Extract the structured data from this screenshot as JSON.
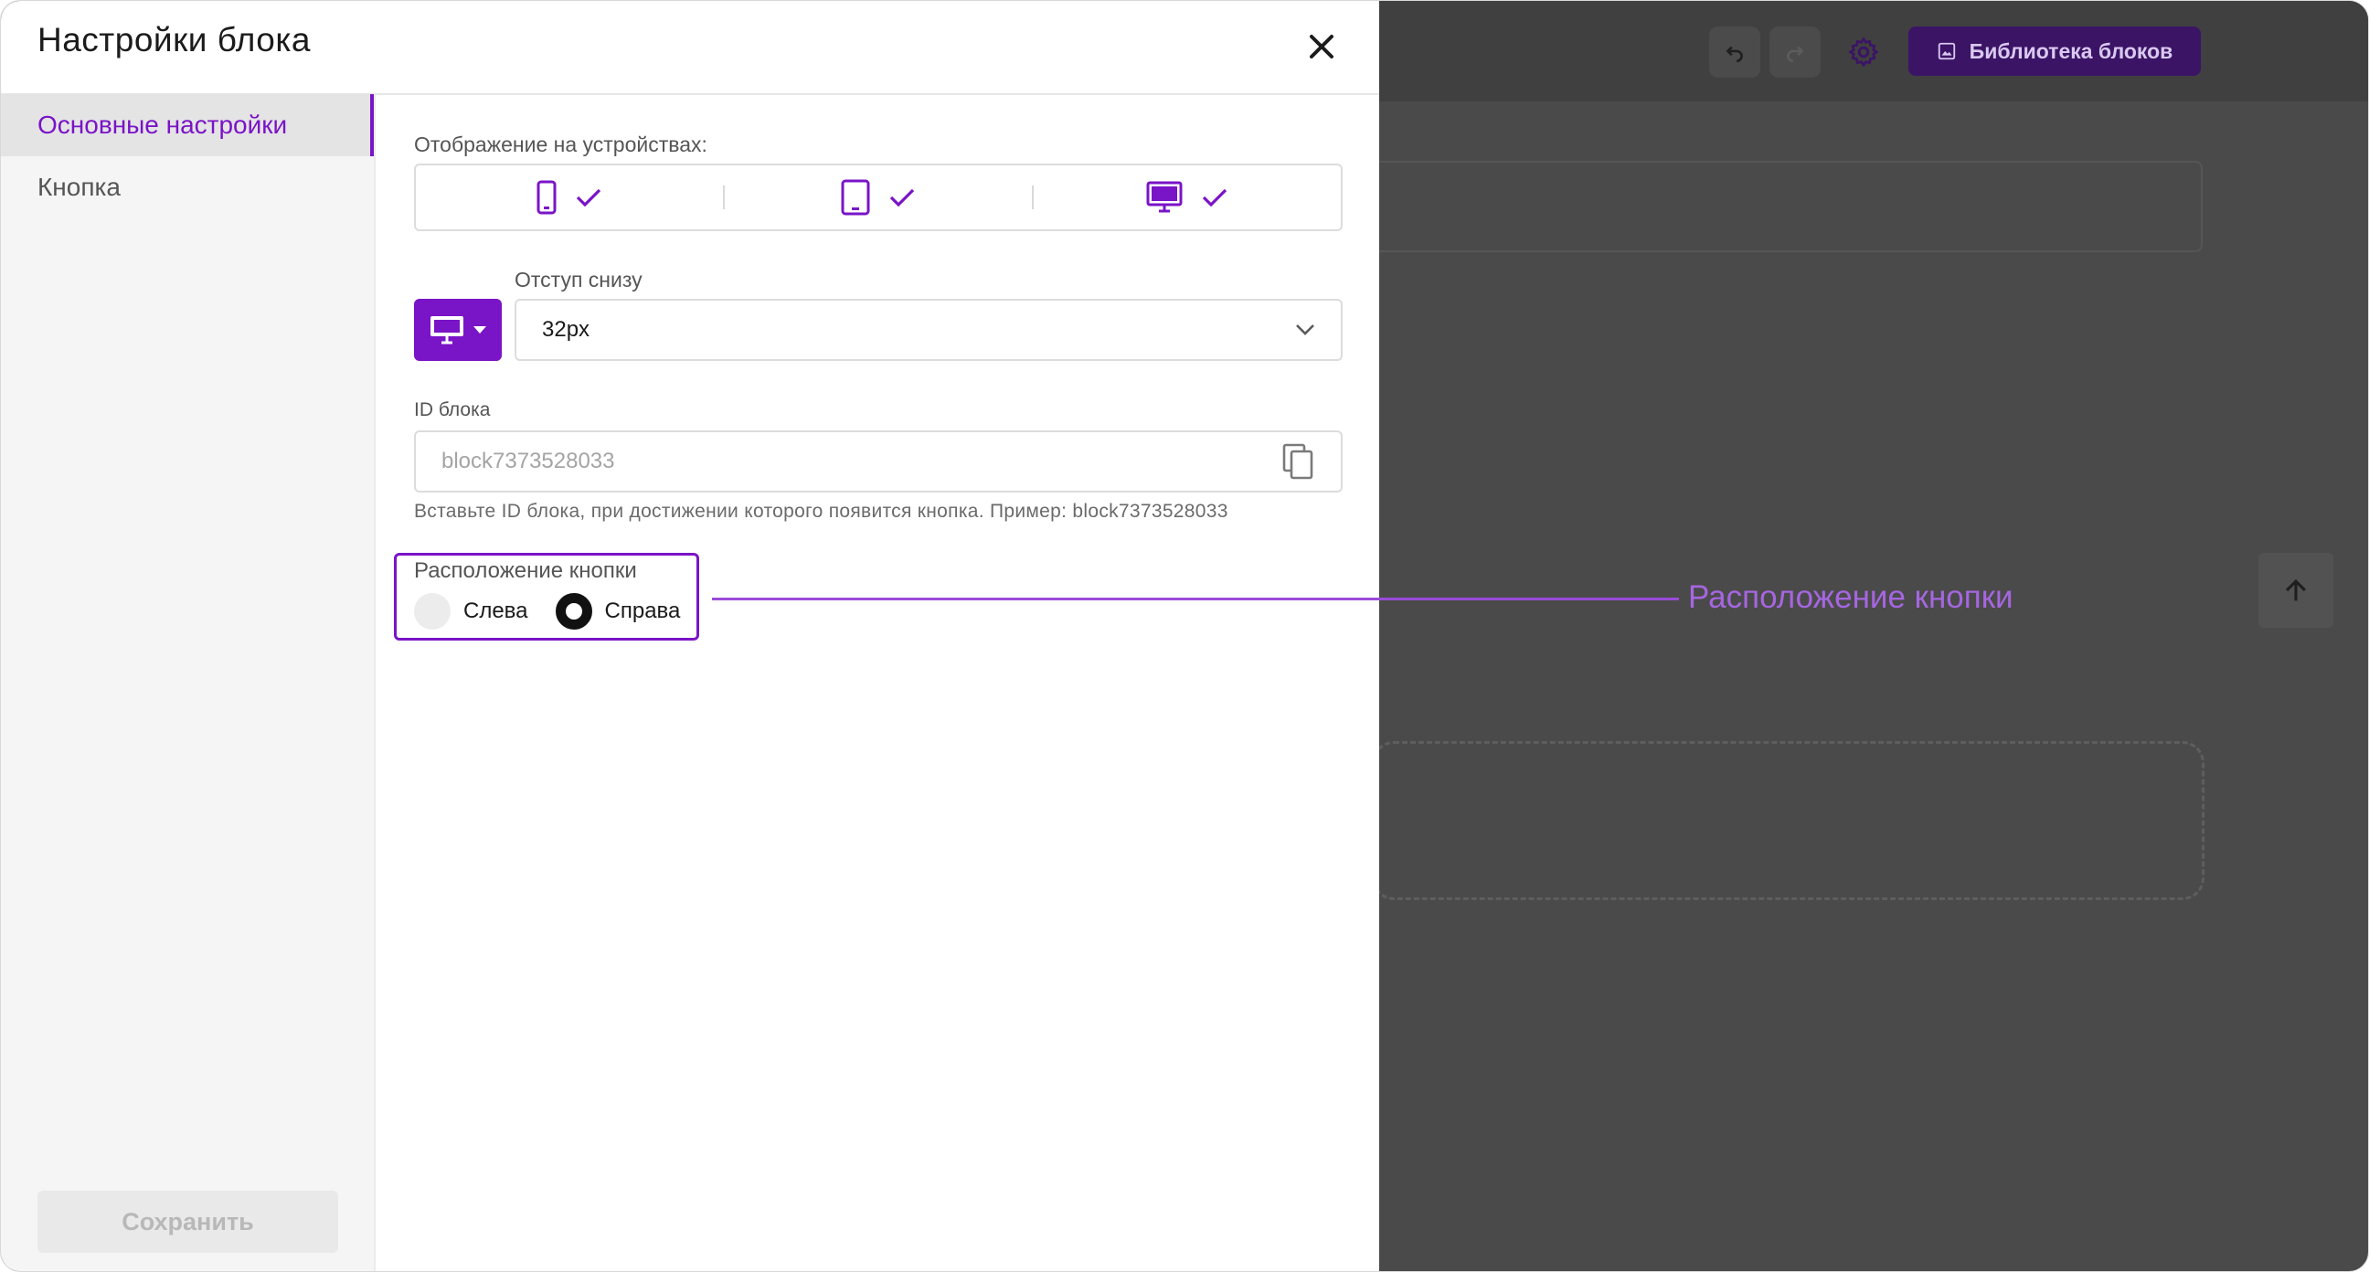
{
  "modal": {
    "title": "Настройки блока",
    "sidebar": {
      "items": [
        {
          "label": "Основные настройки",
          "active": true
        },
        {
          "label": "Кнопка",
          "active": false
        }
      ],
      "save_label": "Сохранить"
    },
    "devices": {
      "label": "Отображение на устройствах:",
      "items": [
        {
          "icon": "mobile-icon",
          "checked": true
        },
        {
          "icon": "tablet-icon",
          "checked": true
        },
        {
          "icon": "desktop-icon",
          "checked": true
        }
      ]
    },
    "bottom_padding": {
      "label": "Отступ снизу",
      "value": "32px",
      "device_icon": "desktop-icon"
    },
    "block_id": {
      "label": "ID блока",
      "placeholder": "block7373528033",
      "hint": "Вставьте ID блока, при достижении которого появится кнопка. Пример: block7373528033"
    },
    "button_position": {
      "label": "Расположение кнопки",
      "options": [
        {
          "label": "Слева",
          "selected": false
        },
        {
          "label": "Справа",
          "selected": true
        }
      ]
    }
  },
  "editor": {
    "library_label": "Библиотека блоков"
  },
  "annotation": {
    "text": "Расположение кнопки"
  },
  "colors": {
    "accent": "#7a14c7",
    "annotation": "#a666e0",
    "overlay": "#4a4a4a"
  }
}
